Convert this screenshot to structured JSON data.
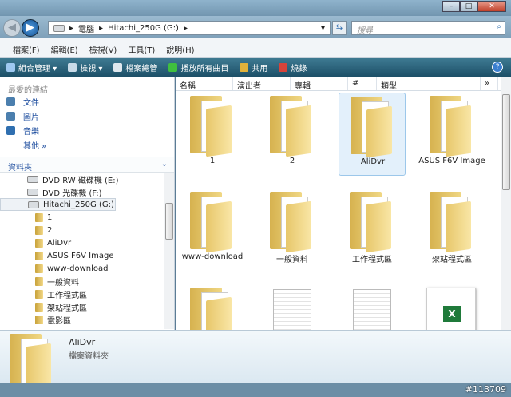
{
  "window": {
    "minimize": "–",
    "maximize": "□",
    "close": "✕"
  },
  "address": {
    "segments": [
      "電腦",
      "Hitachi_250G (G:)"
    ],
    "search_placeholder": "搜尋"
  },
  "menu": [
    "檔案(F)",
    "編輯(E)",
    "檢視(V)",
    "工具(T)",
    "說明(H)"
  ],
  "toolbar": [
    {
      "label": "組合管理 ▾",
      "icon": "organize-icon",
      "color": "#9ec8f0"
    },
    {
      "label": "檢視 ▾",
      "icon": "views-icon",
      "color": "#c9dbe8"
    },
    {
      "label": "檔案總管",
      "icon": "explorer-icon",
      "color": "#e0e8ee"
    },
    {
      "label": "播放所有曲目",
      "icon": "play-icon",
      "color": "#3fbf3f"
    },
    {
      "label": "共用",
      "icon": "share-icon",
      "color": "#e2b23a"
    },
    {
      "label": "燒錄",
      "icon": "burn-icon",
      "color": "#d8433a"
    }
  ],
  "favorites": {
    "title": "最愛的連結",
    "items": [
      "文件",
      "圖片",
      "音樂"
    ],
    "more": "其他 »"
  },
  "folders": {
    "title": "資料夾",
    "tree": [
      {
        "label": "DVD RW 磁碟機 (E:)",
        "type": "drive",
        "level": 0
      },
      {
        "label": "DVD 光碟機 (F:)",
        "type": "drive",
        "level": 0
      },
      {
        "label": "Hitachi_250G (G:)",
        "type": "drive",
        "level": 0,
        "selected": true
      },
      {
        "label": "1",
        "type": "folder",
        "level": 1
      },
      {
        "label": "2",
        "type": "folder",
        "level": 1
      },
      {
        "label": "AliDvr",
        "type": "folder",
        "level": 1
      },
      {
        "label": "ASUS F6V Image",
        "type": "folder",
        "level": 1
      },
      {
        "label": "www-download",
        "type": "folder",
        "level": 1
      },
      {
        "label": "一般資料",
        "type": "folder",
        "level": 1
      },
      {
        "label": "工作程式區",
        "type": "folder",
        "level": 1
      },
      {
        "label": "架站程式區",
        "type": "folder",
        "level": 1
      },
      {
        "label": "電影區",
        "type": "folder",
        "level": 1
      }
    ]
  },
  "columns": [
    "名稱",
    "演出者",
    "專輯",
    "#",
    "類型",
    "»"
  ],
  "items": [
    {
      "label": "1",
      "type": "folder"
    },
    {
      "label": "2",
      "type": "folder"
    },
    {
      "label": "AliDvr",
      "type": "folder",
      "selected": true
    },
    {
      "label": "ASUS F6V Image",
      "type": "folder"
    },
    {
      "label": "www-download",
      "type": "folder"
    },
    {
      "label": "一般資料",
      "type": "folder"
    },
    {
      "label": "工作程式區",
      "type": "folder"
    },
    {
      "label": "架站程式區",
      "type": "folder"
    },
    {
      "label": "",
      "type": "folder"
    },
    {
      "label": "",
      "type": "document"
    },
    {
      "label": "",
      "type": "document"
    },
    {
      "label": "",
      "type": "excel"
    }
  ],
  "details": {
    "name": "AliDvr",
    "type": "檔案資料夾"
  },
  "watermark": "#113709"
}
